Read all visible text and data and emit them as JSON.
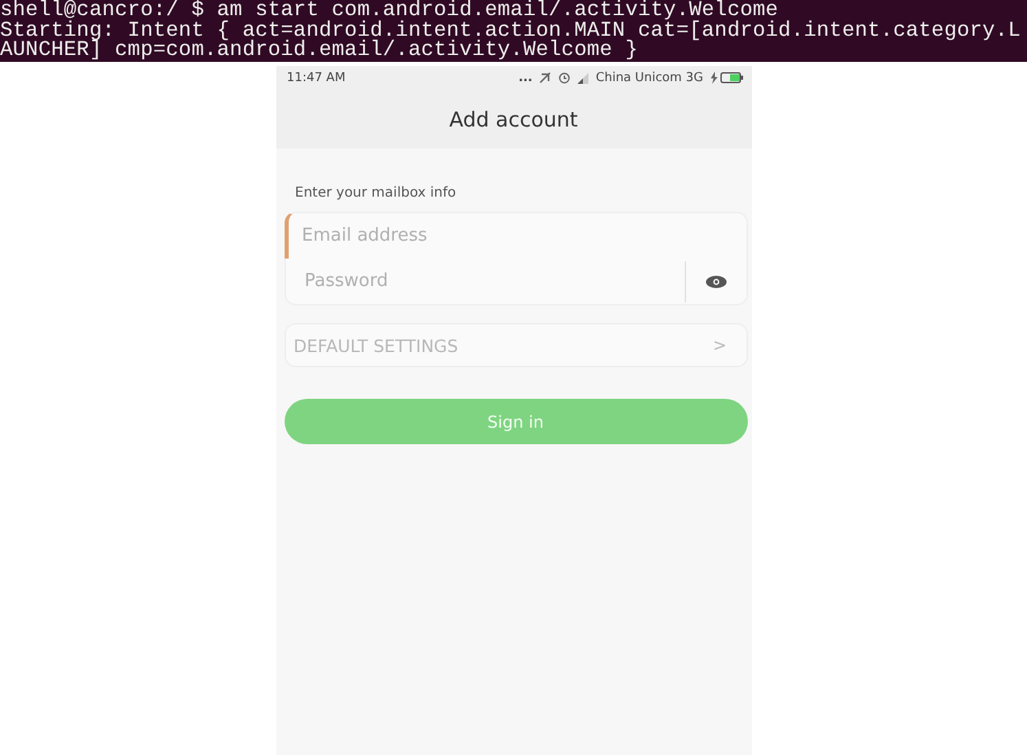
{
  "terminal": {
    "lines": [
      "shell@cancro:/ $ am start com.android.email/.activity.Welcome",
      "Starting: Intent { act=android.intent.action.MAIN cat=[android.intent.category.L",
      "AUNCHER] cmp=com.android.email/.activity.Welcome }"
    ]
  },
  "status_bar": {
    "time": "11:47 AM",
    "overflow": "...",
    "carrier": "China Unicom 3G"
  },
  "title": "Add account",
  "section_label": "Enter your mailbox info",
  "email_field": {
    "placeholder": "Email address",
    "focused": true
  },
  "password_field": {
    "placeholder": "Password"
  },
  "settings_row": {
    "label": "DEFAULT SETTINGS",
    "chevron": ">"
  },
  "sign_in": {
    "label": "Sign in",
    "disabled": true
  }
}
